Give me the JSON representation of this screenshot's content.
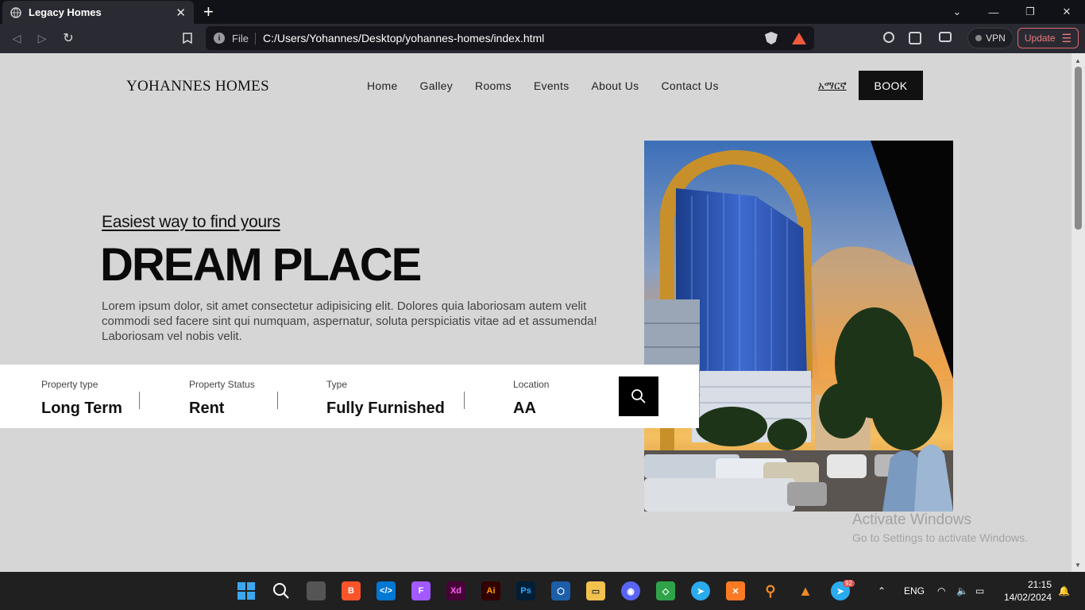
{
  "browser": {
    "tab_title": "Legacy Homes",
    "url_scheme": "File",
    "url": "C:/Users/Yohannes/Desktop/yohannes-homes/index.html",
    "vpn_label": "VPN",
    "update_label": "Update"
  },
  "site": {
    "brand": "YOHANNES HOMES",
    "nav": [
      "Home",
      "Galley",
      "Rooms",
      "Events",
      "About Us",
      "Contact Us"
    ],
    "lang": "አማርኛ",
    "book": "BOOK"
  },
  "hero": {
    "subtitle": "Easiest way to find yours",
    "headline": "DREAM PLACE",
    "description": "Lorem ipsum dolor, sit amet consectetur adipisicing elit. Dolores quia laboriosam autem velit commodi sed facere sint qui numquam, aspernatur, soluta perspiciatis vitae ad et assumenda! Laboriosam vel nobis velit."
  },
  "search": {
    "fields": [
      {
        "label": "Property type",
        "value": "Long Term"
      },
      {
        "label": "Property Status",
        "value": "Rent"
      },
      {
        "label": "Type",
        "value": "Fully Furnished"
      },
      {
        "label": "Location",
        "value": "AA"
      }
    ]
  },
  "watermark": {
    "line1": "Activate Windows",
    "line2": "Go to Settings to activate Windows."
  },
  "taskbar": {
    "apps": [
      "windows-start",
      "search",
      "task-view",
      "brave",
      "vscode",
      "figma",
      "adobe-xd",
      "illustrator",
      "photoshop",
      "virtualbox",
      "file-explorer",
      "discord",
      "app-green",
      "telegram",
      "xampp",
      "search-tool",
      "vlc",
      "telegram-2"
    ],
    "telegram_badge": "92",
    "lang": "ENG",
    "time": "21:15",
    "date": "14/02/2024"
  }
}
